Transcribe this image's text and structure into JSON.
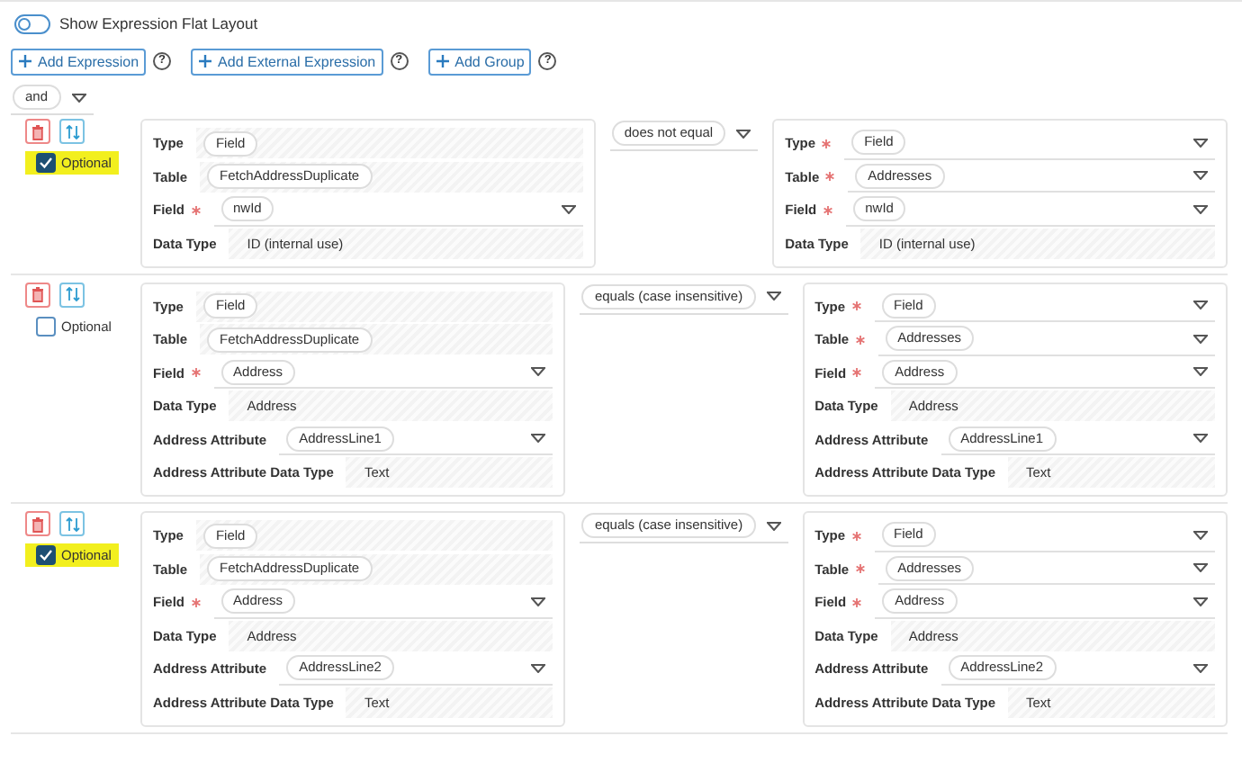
{
  "flat_layout_toggle": {
    "label": "Show Expression Flat Layout",
    "on": false
  },
  "add_buttons": [
    {
      "label": "Add Expression",
      "help": "?"
    },
    {
      "label": "Add External Expression",
      "help": "?"
    },
    {
      "label": "Add Group",
      "help": "?"
    }
  ],
  "logic_operator": "and",
  "expressions": [
    {
      "optional": true,
      "highlighted": true,
      "optional_label": "Optional",
      "operator": "does not equal",
      "left": [
        {
          "label": "Type",
          "required": false,
          "kind": "locked",
          "value": "Field",
          "chip": true
        },
        {
          "label": "Table",
          "required": false,
          "kind": "locked",
          "value": "FetchAddressDuplicate",
          "chip": true
        },
        {
          "label": "Field",
          "required": true,
          "kind": "select",
          "value": "nwId",
          "chip": true
        },
        {
          "label": "Data Type",
          "required": false,
          "kind": "locked",
          "value": "ID (internal use)",
          "chip": false
        }
      ],
      "right": [
        {
          "label": "Type",
          "required": true,
          "kind": "select",
          "value": "Field",
          "chip": true
        },
        {
          "label": "Table",
          "required": true,
          "kind": "select",
          "value": "Addresses",
          "chip": true
        },
        {
          "label": "Field",
          "required": true,
          "kind": "select",
          "value": "nwId",
          "chip": true
        },
        {
          "label": "Data Type",
          "required": false,
          "kind": "locked",
          "value": "ID (internal use)",
          "chip": false
        }
      ]
    },
    {
      "optional": false,
      "highlighted": false,
      "optional_label": "Optional",
      "operator": "equals (case insensitive)",
      "left": [
        {
          "label": "Type",
          "required": false,
          "kind": "locked",
          "value": "Field",
          "chip": true
        },
        {
          "label": "Table",
          "required": false,
          "kind": "locked",
          "value": "FetchAddressDuplicate",
          "chip": true
        },
        {
          "label": "Field",
          "required": true,
          "kind": "select",
          "value": "Address",
          "chip": true
        },
        {
          "label": "Data Type",
          "required": false,
          "kind": "locked",
          "value": "Address",
          "chip": false
        },
        {
          "label": "Address Attribute",
          "required": false,
          "kind": "select",
          "value": "AddressLine1",
          "chip": true
        },
        {
          "label": "Address Attribute Data Type",
          "required": false,
          "kind": "locked",
          "value": "Text",
          "chip": false
        }
      ],
      "right": [
        {
          "label": "Type",
          "required": true,
          "kind": "select",
          "value": "Field",
          "chip": true
        },
        {
          "label": "Table",
          "required": true,
          "kind": "select",
          "value": "Addresses",
          "chip": true
        },
        {
          "label": "Field",
          "required": true,
          "kind": "select",
          "value": "Address",
          "chip": true
        },
        {
          "label": "Data Type",
          "required": false,
          "kind": "locked",
          "value": "Address",
          "chip": false
        },
        {
          "label": "Address Attribute",
          "required": false,
          "kind": "select",
          "value": "AddressLine1",
          "chip": true
        },
        {
          "label": "Address Attribute Data Type",
          "required": false,
          "kind": "locked",
          "value": "Text",
          "chip": false
        }
      ]
    },
    {
      "optional": true,
      "highlighted": true,
      "optional_label": "Optional",
      "operator": "equals (case insensitive)",
      "left": [
        {
          "label": "Type",
          "required": false,
          "kind": "locked",
          "value": "Field",
          "chip": true
        },
        {
          "label": "Table",
          "required": false,
          "kind": "locked",
          "value": "FetchAddressDuplicate",
          "chip": true
        },
        {
          "label": "Field",
          "required": true,
          "kind": "select",
          "value": "Address",
          "chip": true
        },
        {
          "label": "Data Type",
          "required": false,
          "kind": "locked",
          "value": "Address",
          "chip": false
        },
        {
          "label": "Address Attribute",
          "required": false,
          "kind": "select",
          "value": "AddressLine2",
          "chip": true
        },
        {
          "label": "Address Attribute Data Type",
          "required": false,
          "kind": "locked",
          "value": "Text",
          "chip": false
        }
      ],
      "right": [
        {
          "label": "Type",
          "required": true,
          "kind": "select",
          "value": "Field",
          "chip": true
        },
        {
          "label": "Table",
          "required": true,
          "kind": "select",
          "value": "Addresses",
          "chip": true
        },
        {
          "label": "Field",
          "required": true,
          "kind": "select",
          "value": "Address",
          "chip": true
        },
        {
          "label": "Data Type",
          "required": false,
          "kind": "locked",
          "value": "Address",
          "chip": false
        },
        {
          "label": "Address Attribute",
          "required": false,
          "kind": "select",
          "value": "AddressLine2",
          "chip": true
        },
        {
          "label": "Address Attribute Data Type",
          "required": false,
          "kind": "locked",
          "value": "Text",
          "chip": false
        }
      ]
    }
  ]
}
